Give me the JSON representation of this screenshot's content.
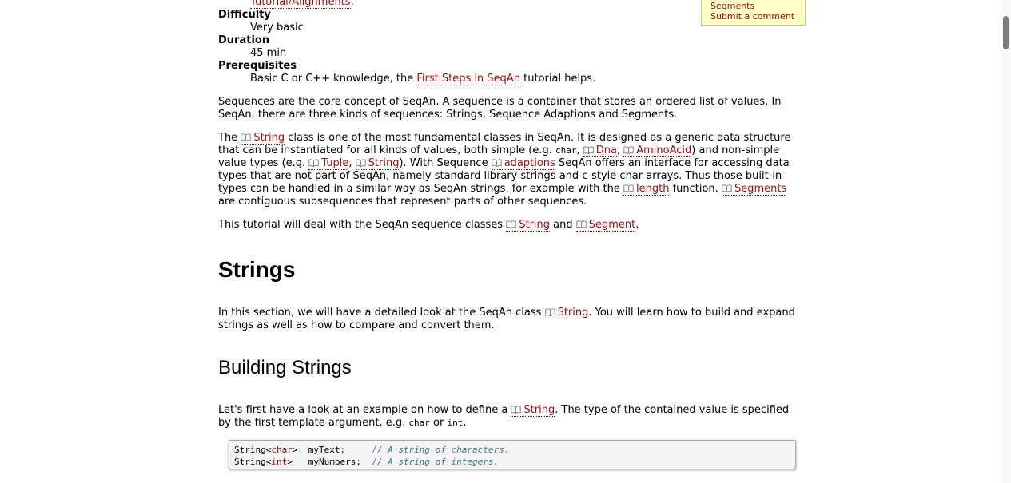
{
  "top_link": "Tutorial/Alignments",
  "defs": [
    {
      "term": "Difficulty",
      "desc": "Very basic"
    },
    {
      "term": "Duration",
      "desc": "45 min"
    }
  ],
  "prereq": {
    "term": "Prerequisites",
    "before": "Basic C or C++ knowledge, the ",
    "link": "First Steps in SeqAn",
    "after": " tutorial helps."
  },
  "note": {
    "link1": "Segments",
    "link2": "Submit a comment"
  },
  "para1": "Sequences are the core concept of SeqAn. A sequence is a container that stores an ordered list of values. In SeqAn, there are three kinds of sequences: Strings, Sequence Adaptions and Segments.",
  "para2": {
    "t1": "The ",
    "l_string": "String",
    "t2": " class is one of the most fundamental classes in SeqAn. It is designed as a generic data structure that can be instantiated for all kinds of values, both simple (e.g. ",
    "c_char": "char",
    "t3": ", ",
    "l_dna": "Dna",
    "t4": ", ",
    "l_aa": "AminoAcid",
    "t5": ") and non-simple value types (e.g. ",
    "l_tuple": "Tuple",
    "t6": ", ",
    "l_string2": "String",
    "t7": "). With Sequence ",
    "l_adaptions": "adaptions",
    "t8": " SeqAn offers an interface for accessing data types that are not part of SeqAn, namely standard library strings and c-style char arrays. Thus those built-in types can be handled in a similar way as SeqAn strings, for example with the ",
    "l_length": "length",
    "t9": " function. ",
    "l_segments": "Segments",
    "t10": " are contiguous subsequences that represent parts of other sequences."
  },
  "para3": {
    "t1": "This tutorial will deal with the SeqAn sequence classes ",
    "l1": "String",
    "t2": " and ",
    "l2": "Segment",
    "t3": "."
  },
  "h_strings": "Strings",
  "para4": {
    "t1": "In this section, we will have a detailed look at the SeqAn class ",
    "l1": "String",
    "t2": ". You will learn how to build and expand strings as well as how to compare and convert them."
  },
  "h_building": "Building Strings",
  "para5": {
    "t1": "Let's first have a look at an example on how to define a ",
    "l1": "String",
    "t2": ". The type of the contained value is specified by the first template argument, e.g. ",
    "c1": "char",
    "t3": " or ",
    "c2": "int",
    "t4": "."
  },
  "code": [
    {
      "pre": "String<",
      "kw": "char",
      "post": ">  myText;     ",
      "comment": "// A string of characters."
    },
    {
      "pre": "String<",
      "kw": "int",
      "post": ">   myNumbers;  ",
      "comment": "// A string of integers."
    }
  ]
}
